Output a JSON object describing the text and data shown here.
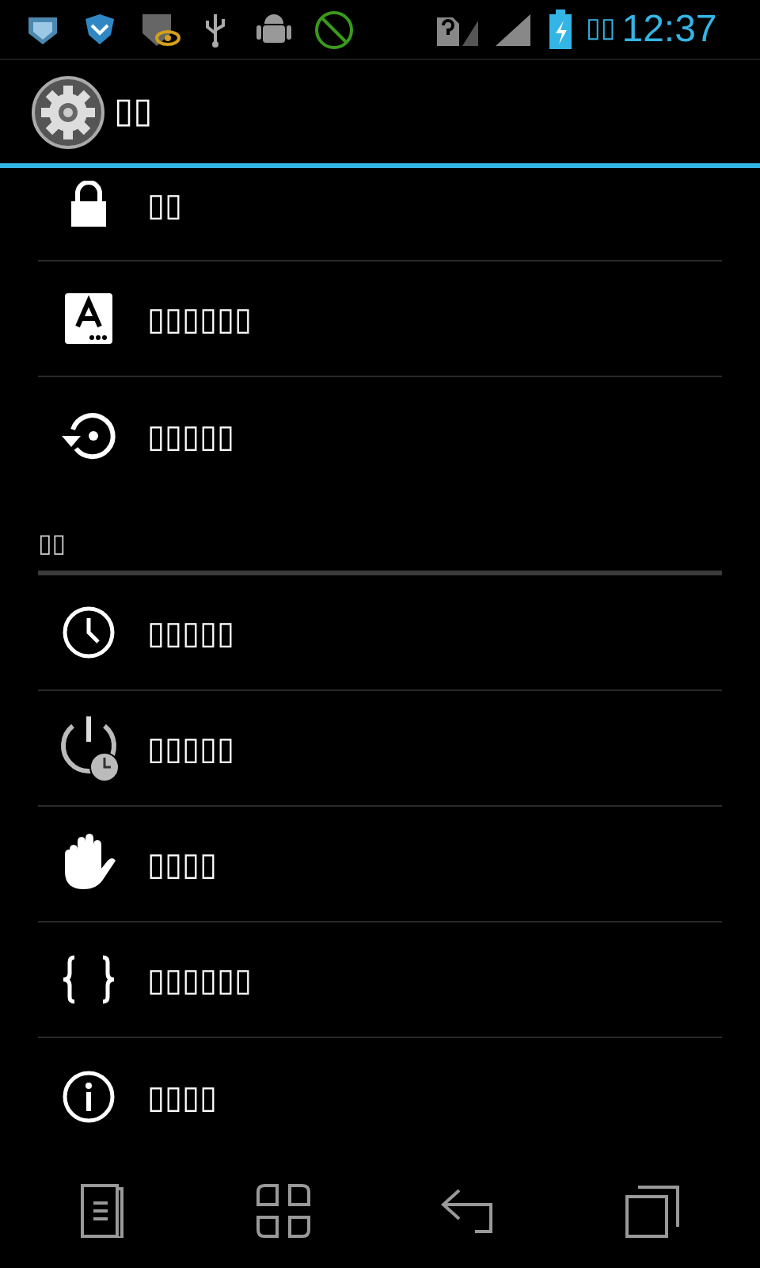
{
  "status_bar": {
    "date": "▯▯",
    "time": "12:37"
  },
  "action_bar": {
    "title": "▯▯"
  },
  "sections": [
    {
      "items": [
        {
          "label": "▯▯"
        },
        {
          "label": "▯▯▯▯▯▯"
        },
        {
          "label": "▯▯▯▯▯"
        }
      ]
    },
    {
      "header": "▯▯",
      "items": [
        {
          "label": "▯▯▯▯▯"
        },
        {
          "label": "▯▯▯▯▯"
        },
        {
          "label": "▯▯▯▯"
        },
        {
          "label": "▯▯▯▯▯▯"
        },
        {
          "label": "▯▯▯▯"
        }
      ]
    }
  ]
}
